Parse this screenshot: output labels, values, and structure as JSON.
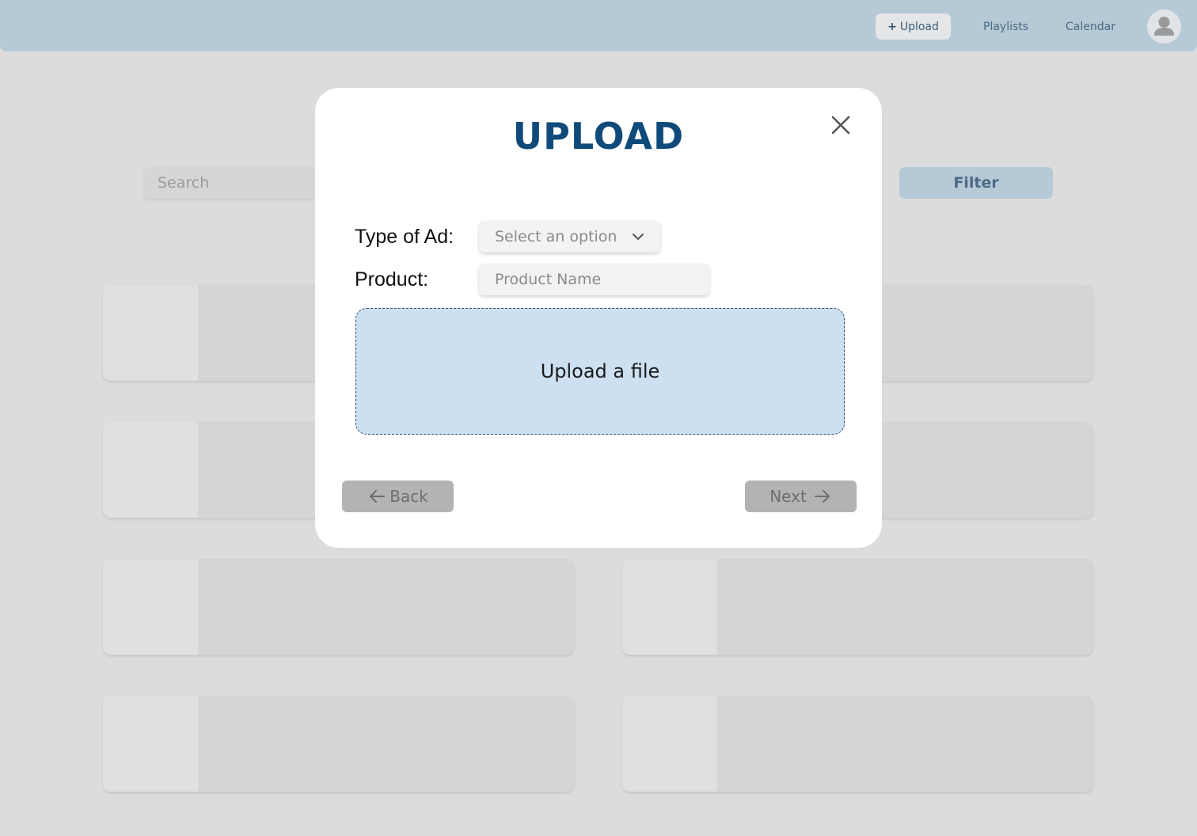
{
  "nav": {
    "upload_plus": "+",
    "upload_label": "Upload",
    "playlists_label": "Playlists",
    "calendar_label": "Calendar",
    "avatar_icon": "user-avatar-icon"
  },
  "background": {
    "search_placeholder": "Search",
    "filter_label": "Filter"
  },
  "modal": {
    "title": "UPLOAD",
    "close_icon": "close-icon",
    "type_label": "Type of Ad:",
    "type_select_value": "Select an option",
    "product_label": "Product:",
    "product_placeholder": "Product Name",
    "dropzone_label": "Upload a file",
    "back_label": "Back",
    "next_label": "Next"
  },
  "colors": {
    "nav_bg": "#b6c9d6",
    "title": "#0f4a7a",
    "dropzone_bg": "#cde0f1",
    "button_bg": "#b3b3b3",
    "page_bg": "#dcdcdc"
  }
}
